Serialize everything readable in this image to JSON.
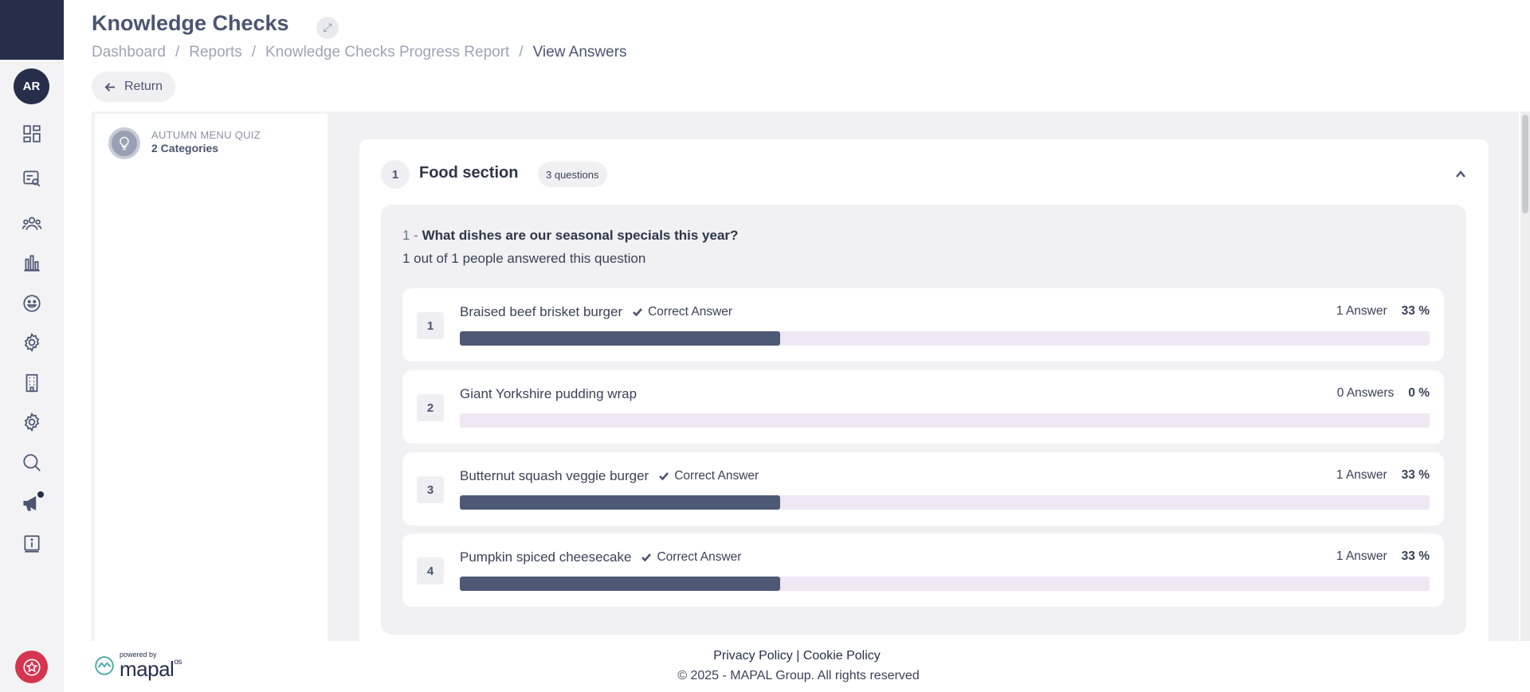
{
  "user": {
    "initials": "AR"
  },
  "header": {
    "title": "Knowledge Checks",
    "breadcrumb": [
      "Dashboard",
      "Reports",
      "Knowledge Checks Progress Report",
      "View Answers"
    ],
    "breadcrumb_sep": "/",
    "return_label": "Return"
  },
  "quiz": {
    "name": "AUTUMN MENU QUIZ",
    "categories": "2 Categories"
  },
  "section": {
    "number": "1",
    "title": "Food section",
    "question_count": "3 questions",
    "question": {
      "prefix": "1 -",
      "text": "What dishes are our seasonal specials this year?",
      "summary": "1 out of 1 people answered this question",
      "answers": [
        {
          "num": "1",
          "label": "Braised beef brisket burger",
          "correct": true,
          "correct_label": "Correct Answer",
          "count": "1 Answer",
          "pct_label": "33 %",
          "pct": 33
        },
        {
          "num": "2",
          "label": "Giant Yorkshire pudding wrap",
          "correct": false,
          "correct_label": "",
          "count": "0 Answers",
          "pct_label": "0 %",
          "pct": 0
        },
        {
          "num": "3",
          "label": "Butternut squash veggie burger",
          "correct": true,
          "correct_label": "Correct Answer",
          "count": "1 Answer",
          "pct_label": "33 %",
          "pct": 33
        },
        {
          "num": "4",
          "label": "Pumpkin spiced cheesecake",
          "correct": true,
          "correct_label": "Correct Answer",
          "count": "1 Answer",
          "pct_label": "33 %",
          "pct": 33
        }
      ]
    }
  },
  "colors": {
    "rail_dark": "#262e4a",
    "bar_fill": "#4e5975",
    "bar_track": "#efe7f1",
    "brand_red": "#d4354f"
  },
  "icons": [
    "dashboard-icon",
    "search-doc-icon",
    "team-icon",
    "chart-icon",
    "smiley-icon",
    "settings-icon",
    "building-icon",
    "gear-icon",
    "search-icon",
    "megaphone-icon",
    "info-doc-icon",
    "star-icon"
  ],
  "footer": {
    "powered_by": "powered by",
    "brand": "mapal",
    "brand_suffix": "os",
    "privacy": "Privacy Policy",
    "divider": "|",
    "cookie": "Cookie Policy",
    "copyright": "© 2025 - MAPAL Group. All rights reserved"
  }
}
